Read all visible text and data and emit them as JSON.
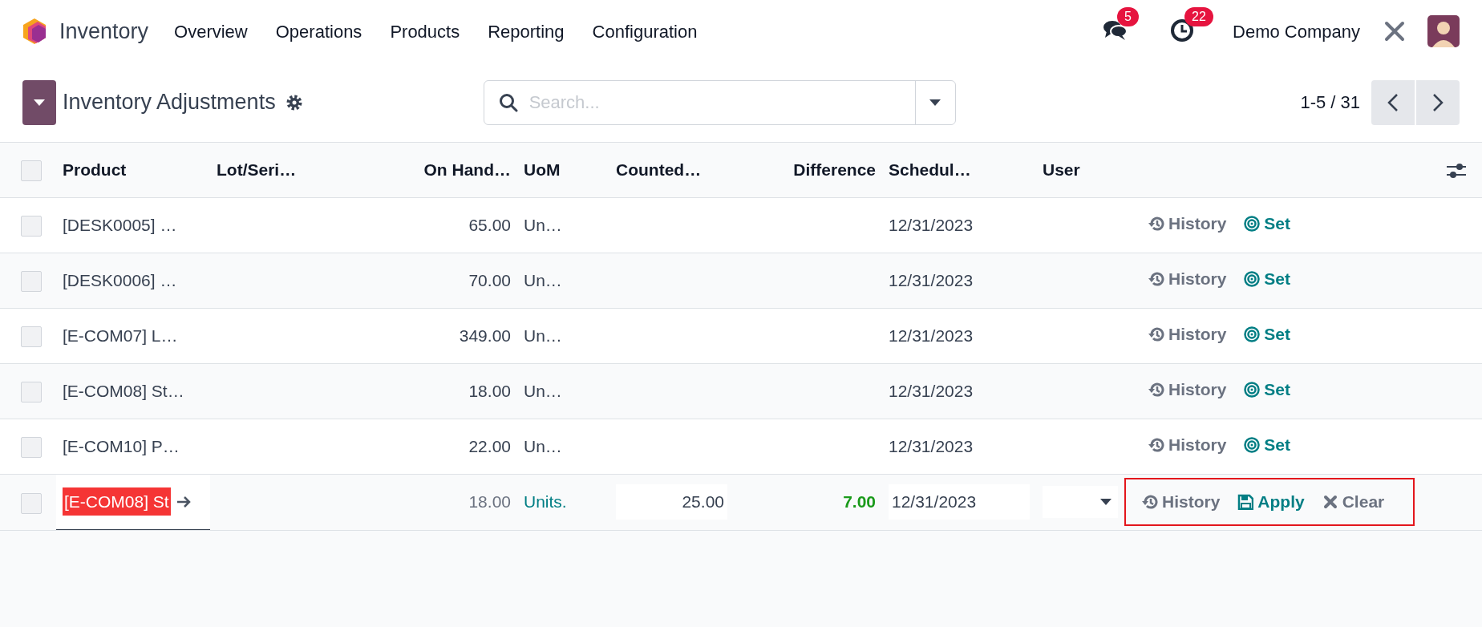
{
  "navbar": {
    "app_name": "Inventory",
    "menu": [
      "Overview",
      "Operations",
      "Products",
      "Reporting",
      "Configuration"
    ],
    "messages_count": "5",
    "activities_count": "22",
    "company": "Demo Company"
  },
  "control_panel": {
    "title": "Inventory Adjustments",
    "search": {
      "placeholder": "Search..."
    },
    "pager": "1-5 / 31"
  },
  "table": {
    "select_all_checked": false,
    "columns": [
      {
        "label": "Product"
      },
      {
        "label": "Lot/Seri…"
      },
      {
        "label": "On Hand…"
      },
      {
        "label": "UoM"
      },
      {
        "label": "Counted…"
      },
      {
        "label": "Difference"
      },
      {
        "label": "Schedul…"
      },
      {
        "label": "User"
      }
    ],
    "rows": [
      {
        "kind": "normal",
        "checked": false,
        "product": "[DESK0005] …",
        "on_hand": "65.00",
        "uom": "Un…",
        "scheduled": "12/31/2023",
        "actions": [
          {
            "kind": "history",
            "label": "History"
          },
          {
            "kind": "set",
            "label": "Set"
          }
        ]
      },
      {
        "kind": "normal",
        "checked": false,
        "product": "[DESK0006] …",
        "on_hand": "70.00",
        "uom": "Un…",
        "scheduled": "12/31/2023",
        "actions": [
          {
            "kind": "history",
            "label": "History"
          },
          {
            "kind": "set",
            "label": "Set"
          }
        ]
      },
      {
        "kind": "normal",
        "checked": false,
        "product": "[E-COM07] L…",
        "on_hand": "349.00",
        "uom": "Un…",
        "scheduled": "12/31/2023",
        "actions": [
          {
            "kind": "history",
            "label": "History"
          },
          {
            "kind": "set",
            "label": "Set"
          }
        ]
      },
      {
        "kind": "normal",
        "checked": false,
        "product": "[E-COM08] St…",
        "on_hand": "18.00",
        "uom": "Un…",
        "scheduled": "12/31/2023",
        "actions": [
          {
            "kind": "history",
            "label": "History"
          },
          {
            "kind": "set",
            "label": "Set"
          }
        ]
      },
      {
        "kind": "normal",
        "checked": false,
        "product": "[E-COM10] P…",
        "on_hand": "22.00",
        "uom": "Un…",
        "scheduled": "12/31/2023",
        "actions": [
          {
            "kind": "history",
            "label": "History"
          },
          {
            "kind": "set",
            "label": "Set"
          }
        ]
      },
      {
        "kind": "editing",
        "checked": false,
        "product": "[E-COM08] St",
        "on_hand": "18.00",
        "uom": "Units.",
        "counted": "25.00",
        "difference": "7.00",
        "scheduled": "12/31/2023",
        "actions_highlighted": true,
        "actions": [
          {
            "kind": "history",
            "label": "History"
          },
          {
            "kind": "apply",
            "label": "Apply"
          },
          {
            "kind": "clear",
            "label": "Clear"
          }
        ]
      }
    ]
  }
}
